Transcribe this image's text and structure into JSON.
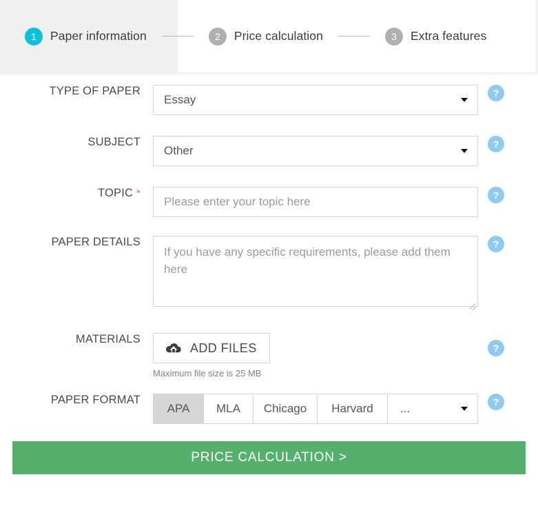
{
  "stepper": {
    "steps": [
      {
        "number": "1",
        "label": "Paper information",
        "state": "active"
      },
      {
        "number": "2",
        "label": "Price calculation",
        "state": "inactive"
      },
      {
        "number": "3",
        "label": "Extra features",
        "state": "inactive"
      }
    ],
    "active_color": "#0ec0da",
    "inactive_color": "#b0b0b0"
  },
  "form": {
    "help_glyph": "?",
    "type_of_paper": {
      "label": "TYPE OF PAPER",
      "value": "Essay"
    },
    "subject": {
      "label": "SUBJECT",
      "value": "Other"
    },
    "topic": {
      "label": "TOPIC",
      "required_mark": "*",
      "placeholder": "Please enter your topic here",
      "value": ""
    },
    "paper_details": {
      "label": "PAPER DETAILS",
      "placeholder": "If you have any specific requirements, please add them here",
      "value": ""
    },
    "materials": {
      "label": "MATERIALS",
      "button_label": "ADD FILES",
      "icon": "cloud-upload-icon",
      "hint": "Maximum file size is 25 MB"
    },
    "paper_format": {
      "label": "PAPER FORMAT",
      "options": [
        {
          "label": "APA",
          "selected": true
        },
        {
          "label": "MLA",
          "selected": false
        },
        {
          "label": "Chicago",
          "selected": false
        },
        {
          "label": "Harvard",
          "selected": false
        }
      ],
      "more_label": "..."
    }
  },
  "submit": {
    "label": "PRICE CALCULATION >",
    "color": "#54b06a"
  }
}
